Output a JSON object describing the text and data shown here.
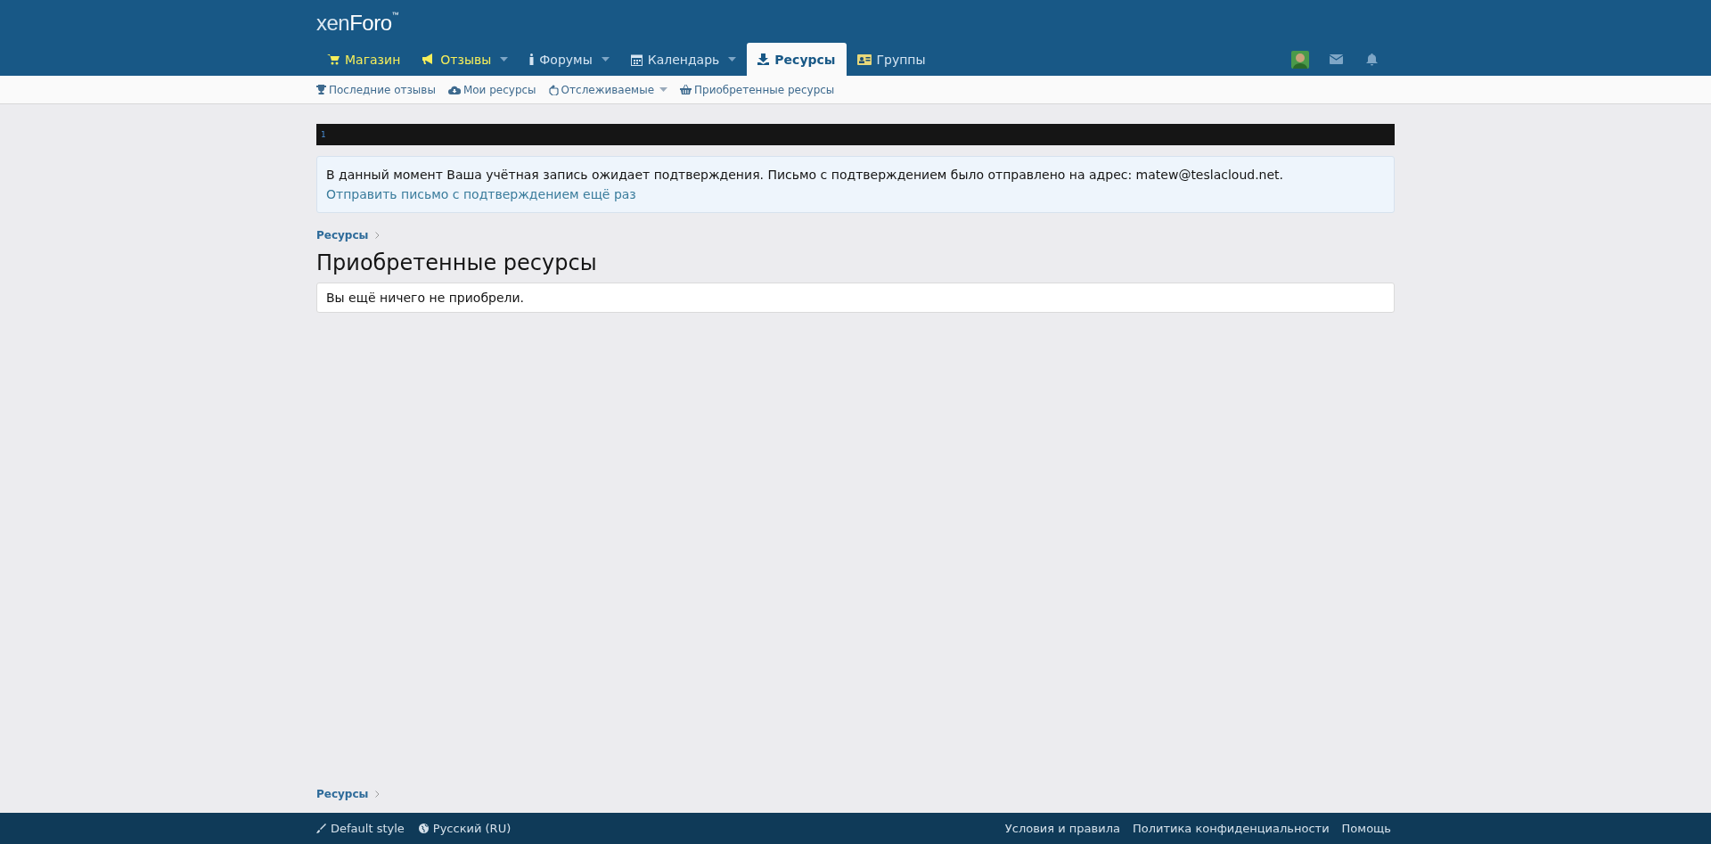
{
  "logo": {
    "text_light": "xen",
    "text_bold": "Foro",
    "mark": "™"
  },
  "nav_tabs": [
    {
      "label": "Магазин",
      "highlighted": true,
      "has_menu": false,
      "selected": false
    },
    {
      "label": "Отзывы",
      "highlighted": true,
      "has_menu": true,
      "selected": false
    },
    {
      "label": "Форумы",
      "highlighted": false,
      "has_menu": true,
      "selected": false
    },
    {
      "label": "Календарь",
      "highlighted": false,
      "has_menu": true,
      "selected": false
    },
    {
      "label": "Ресурсы",
      "highlighted": false,
      "has_menu": false,
      "selected": true
    },
    {
      "label": "Группы",
      "highlighted": false,
      "has_menu": false,
      "selected": false
    }
  ],
  "sub_nav": [
    {
      "label": "Последние отзывы",
      "has_menu": false
    },
    {
      "label": "Мои ресурсы",
      "has_menu": false
    },
    {
      "label": "Отслеживаемые",
      "has_menu": true
    },
    {
      "label": "Приобретенные ресурсы",
      "has_menu": false
    }
  ],
  "code_bar": {
    "text": "1"
  },
  "notice": {
    "text": "В данный момент Ваша учётная запись ожидает подтверждения. Письмо с подтверждением было отправлено на адрес: matew@teslacloud.net.",
    "link": "Отправить письмо с подтверждением ещё раз"
  },
  "breadcrumb_top": [
    "Ресурсы"
  ],
  "page_title": "Приобретенные ресурсы",
  "empty_message": "Вы ещё ничего не приобрели.",
  "breadcrumb_bottom": [
    "Ресурсы"
  ],
  "footer": {
    "left": [
      "Default style",
      "Русский (RU)"
    ],
    "right": [
      "Условия и правила",
      "Политика конфиденциальности",
      "Помощь"
    ]
  }
}
